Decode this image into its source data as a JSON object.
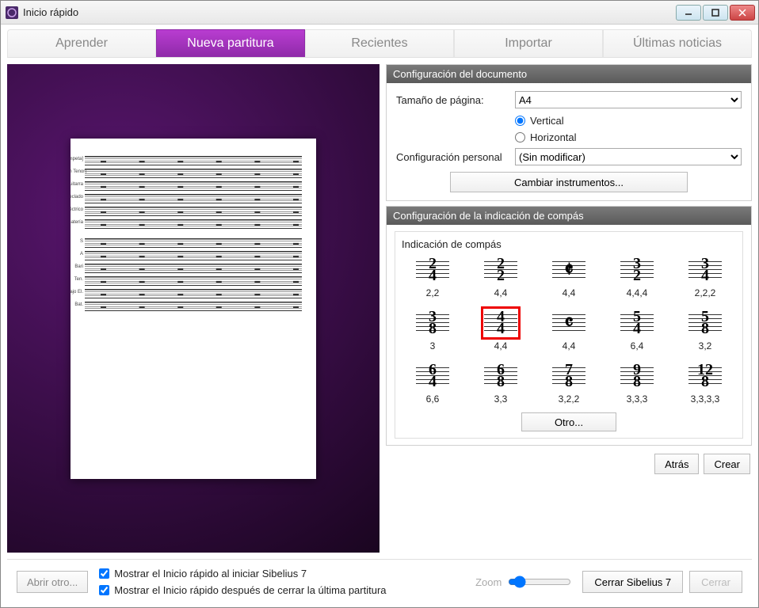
{
  "window": {
    "title": "Inicio rápido"
  },
  "tabs": {
    "learn": "Aprender",
    "new_score": "Nueva partitura",
    "recent": "Recientes",
    "import": "Importar",
    "news": "Últimas noticias"
  },
  "preview": {
    "instruments_top": [
      "[Trompeta]",
      "[Saxofón Tenor]",
      "Guitarra",
      "Teclado",
      "Bajo Eléctrico",
      "Batería"
    ],
    "instruments_bottom": [
      "S",
      "A",
      "Bari",
      "Ten.",
      "Bajo El.",
      "Bat."
    ]
  },
  "doc_panel": {
    "header": "Configuración del documento",
    "page_size_label": "Tamaño de página:",
    "page_size_value": "A4",
    "orientation_vertical": "Vertical",
    "orientation_horizontal": "Horizontal",
    "personal_label": "Configuración personal",
    "personal_value": "(Sin modificar)",
    "change_instruments": "Cambiar instrumentos..."
  },
  "ts_panel": {
    "header": "Configuración de la indicación de compás",
    "box_title": "Indicación de compás",
    "other": "Otro...",
    "cells": [
      {
        "num": "2",
        "den": "4",
        "caption": "2,2"
      },
      {
        "num": "2",
        "den": "2",
        "caption": "4,4"
      },
      {
        "sym": "𝄵",
        "caption": "4,4"
      },
      {
        "num": "3",
        "den": "2",
        "caption": "4,4,4"
      },
      {
        "num": "3",
        "den": "4",
        "caption": "2,2,2"
      },
      {
        "num": "3",
        "den": "8",
        "caption": "3"
      },
      {
        "num": "4",
        "den": "4",
        "caption": "4,4",
        "selected": true
      },
      {
        "sym": "𝄴",
        "caption": "4,4"
      },
      {
        "num": "5",
        "den": "4",
        "caption": "6,4"
      },
      {
        "num": "5",
        "den": "8",
        "caption": "3,2"
      },
      {
        "num": "6",
        "den": "4",
        "caption": "6,6"
      },
      {
        "num": "6",
        "den": "8",
        "caption": "3,3"
      },
      {
        "num": "7",
        "den": "8",
        "caption": "3,2,2"
      },
      {
        "num": "9",
        "den": "8",
        "caption": "3,3,3"
      },
      {
        "num": "12",
        "den": "8",
        "caption": "3,3,3,3"
      }
    ]
  },
  "nav": {
    "back": "Atrás",
    "create": "Crear"
  },
  "footer": {
    "open_other": "Abrir otro...",
    "chk_startup": "Mostrar el Inicio rápido al iniciar Sibelius 7",
    "chk_after_close": "Mostrar el Inicio rápido después de cerrar la última partitura",
    "zoom_label": "Zoom",
    "close_app": "Cerrar Sibelius 7",
    "close": "Cerrar"
  }
}
